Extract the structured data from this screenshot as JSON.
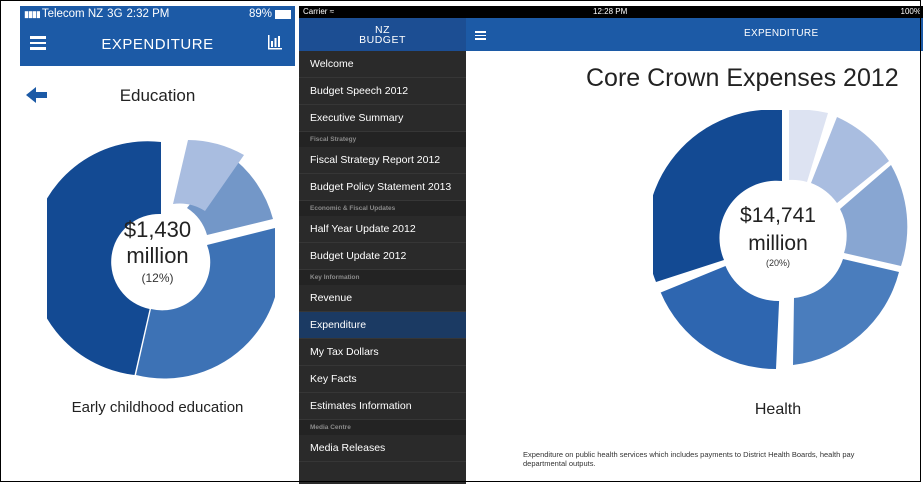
{
  "phone": {
    "status": {
      "carrier": "Telecom NZ",
      "network": "3G",
      "time": "2:32 PM",
      "battery": "89%"
    },
    "nav": {
      "title": "EXPENDITURE"
    },
    "heading": "Education",
    "donut": {
      "value": "$1,430",
      "unit": "million",
      "percent": "(12%)"
    },
    "caption": "Early childhood education"
  },
  "tablet": {
    "status": {
      "carrier": "Carrier",
      "time": "12:28 PM",
      "battery": "100%"
    },
    "logo": {
      "line1": "NZ",
      "line2": "BUDGET"
    },
    "menu": [
      {
        "label": "Welcome"
      },
      {
        "label": "Budget Speech 2012"
      },
      {
        "label": "Executive Summary"
      },
      {
        "label": "Fiscal Strategy"
      },
      {
        "label": "Fiscal Strategy Report 2012"
      },
      {
        "label": "Budget Policy Statement 2013"
      },
      {
        "label": "Economic & Fiscal Updates"
      },
      {
        "label": "Half Year Update 2012"
      },
      {
        "label": "Budget Update 2012"
      },
      {
        "label": "Key Information"
      },
      {
        "label": "Revenue"
      },
      {
        "label": "Expenditure"
      },
      {
        "label": "My Tax Dollars"
      },
      {
        "label": "Key Facts"
      },
      {
        "label": "Estimates Information"
      },
      {
        "label": "Media Centre"
      },
      {
        "label": "Media Releases"
      }
    ],
    "nav": {
      "title": "EXPENDITURE"
    },
    "heading": "Core Crown Expenses 2012",
    "donut": {
      "value": "$14,741",
      "unit": "million",
      "percent": "(20%)"
    },
    "caption": "Health",
    "description_line1": "Expenditure on public health services which includes payments to District Health Boards, health pay",
    "description_line2": "departmental outputs."
  },
  "colors": {
    "brand_blue": "#1c5aa6",
    "sidebar_bg": "#2a2a2a",
    "sidebar_active": "#1b3a63"
  },
  "icons": [
    "signal-icon",
    "battery-icon",
    "hamburger-menu-icon",
    "bar-chart-icon",
    "back-arrow-icon",
    "wifi-icon"
  ]
}
